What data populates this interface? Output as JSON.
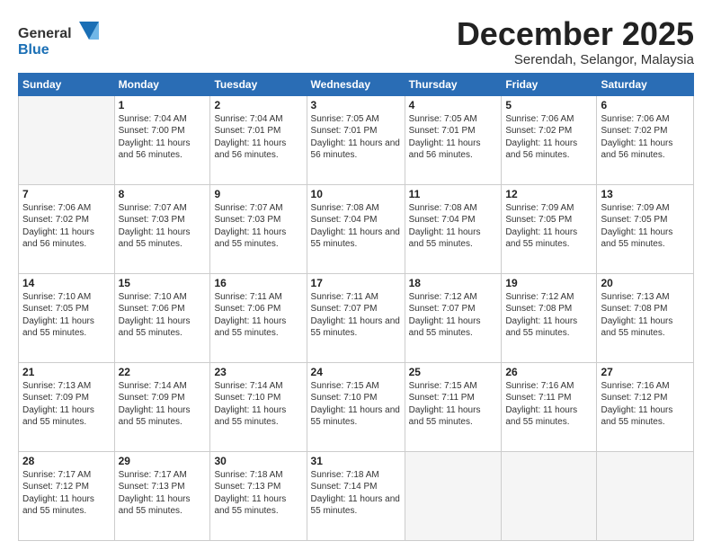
{
  "logo": {
    "line1": "General",
    "line2": "Blue"
  },
  "header": {
    "month": "December 2025",
    "location": "Serendah, Selangor, Malaysia"
  },
  "weekdays": [
    "Sunday",
    "Monday",
    "Tuesday",
    "Wednesday",
    "Thursday",
    "Friday",
    "Saturday"
  ],
  "weeks": [
    [
      {
        "day": "",
        "empty": true
      },
      {
        "day": "1",
        "rise": "7:04 AM",
        "set": "7:00 PM",
        "daylight": "11 hours and 56 minutes."
      },
      {
        "day": "2",
        "rise": "7:04 AM",
        "set": "7:01 PM",
        "daylight": "11 hours and 56 minutes."
      },
      {
        "day": "3",
        "rise": "7:05 AM",
        "set": "7:01 PM",
        "daylight": "11 hours and 56 minutes."
      },
      {
        "day": "4",
        "rise": "7:05 AM",
        "set": "7:01 PM",
        "daylight": "11 hours and 56 minutes."
      },
      {
        "day": "5",
        "rise": "7:06 AM",
        "set": "7:02 PM",
        "daylight": "11 hours and 56 minutes."
      },
      {
        "day": "6",
        "rise": "7:06 AM",
        "set": "7:02 PM",
        "daylight": "11 hours and 56 minutes."
      }
    ],
    [
      {
        "day": "7",
        "rise": "7:06 AM",
        "set": "7:02 PM",
        "daylight": "11 hours and 56 minutes."
      },
      {
        "day": "8",
        "rise": "7:07 AM",
        "set": "7:03 PM",
        "daylight": "11 hours and 55 minutes."
      },
      {
        "day": "9",
        "rise": "7:07 AM",
        "set": "7:03 PM",
        "daylight": "11 hours and 55 minutes."
      },
      {
        "day": "10",
        "rise": "7:08 AM",
        "set": "7:04 PM",
        "daylight": "11 hours and 55 minutes."
      },
      {
        "day": "11",
        "rise": "7:08 AM",
        "set": "7:04 PM",
        "daylight": "11 hours and 55 minutes."
      },
      {
        "day": "12",
        "rise": "7:09 AM",
        "set": "7:05 PM",
        "daylight": "11 hours and 55 minutes."
      },
      {
        "day": "13",
        "rise": "7:09 AM",
        "set": "7:05 PM",
        "daylight": "11 hours and 55 minutes."
      }
    ],
    [
      {
        "day": "14",
        "rise": "7:10 AM",
        "set": "7:05 PM",
        "daylight": "11 hours and 55 minutes."
      },
      {
        "day": "15",
        "rise": "7:10 AM",
        "set": "7:06 PM",
        "daylight": "11 hours and 55 minutes."
      },
      {
        "day": "16",
        "rise": "7:11 AM",
        "set": "7:06 PM",
        "daylight": "11 hours and 55 minutes."
      },
      {
        "day": "17",
        "rise": "7:11 AM",
        "set": "7:07 PM",
        "daylight": "11 hours and 55 minutes."
      },
      {
        "day": "18",
        "rise": "7:12 AM",
        "set": "7:07 PM",
        "daylight": "11 hours and 55 minutes."
      },
      {
        "day": "19",
        "rise": "7:12 AM",
        "set": "7:08 PM",
        "daylight": "11 hours and 55 minutes."
      },
      {
        "day": "20",
        "rise": "7:13 AM",
        "set": "7:08 PM",
        "daylight": "11 hours and 55 minutes."
      }
    ],
    [
      {
        "day": "21",
        "rise": "7:13 AM",
        "set": "7:09 PM",
        "daylight": "11 hours and 55 minutes."
      },
      {
        "day": "22",
        "rise": "7:14 AM",
        "set": "7:09 PM",
        "daylight": "11 hours and 55 minutes."
      },
      {
        "day": "23",
        "rise": "7:14 AM",
        "set": "7:10 PM",
        "daylight": "11 hours and 55 minutes."
      },
      {
        "day": "24",
        "rise": "7:15 AM",
        "set": "7:10 PM",
        "daylight": "11 hours and 55 minutes."
      },
      {
        "day": "25",
        "rise": "7:15 AM",
        "set": "7:11 PM",
        "daylight": "11 hours and 55 minutes."
      },
      {
        "day": "26",
        "rise": "7:16 AM",
        "set": "7:11 PM",
        "daylight": "11 hours and 55 minutes."
      },
      {
        "day": "27",
        "rise": "7:16 AM",
        "set": "7:12 PM",
        "daylight": "11 hours and 55 minutes."
      }
    ],
    [
      {
        "day": "28",
        "rise": "7:17 AM",
        "set": "7:12 PM",
        "daylight": "11 hours and 55 minutes."
      },
      {
        "day": "29",
        "rise": "7:17 AM",
        "set": "7:13 PM",
        "daylight": "11 hours and 55 minutes."
      },
      {
        "day": "30",
        "rise": "7:18 AM",
        "set": "7:13 PM",
        "daylight": "11 hours and 55 minutes."
      },
      {
        "day": "31",
        "rise": "7:18 AM",
        "set": "7:14 PM",
        "daylight": "11 hours and 55 minutes."
      },
      {
        "day": "",
        "empty": true
      },
      {
        "day": "",
        "empty": true
      },
      {
        "day": "",
        "empty": true
      }
    ]
  ],
  "labels": {
    "sunrise": "Sunrise:",
    "sunset": "Sunset:",
    "daylight": "Daylight:"
  }
}
